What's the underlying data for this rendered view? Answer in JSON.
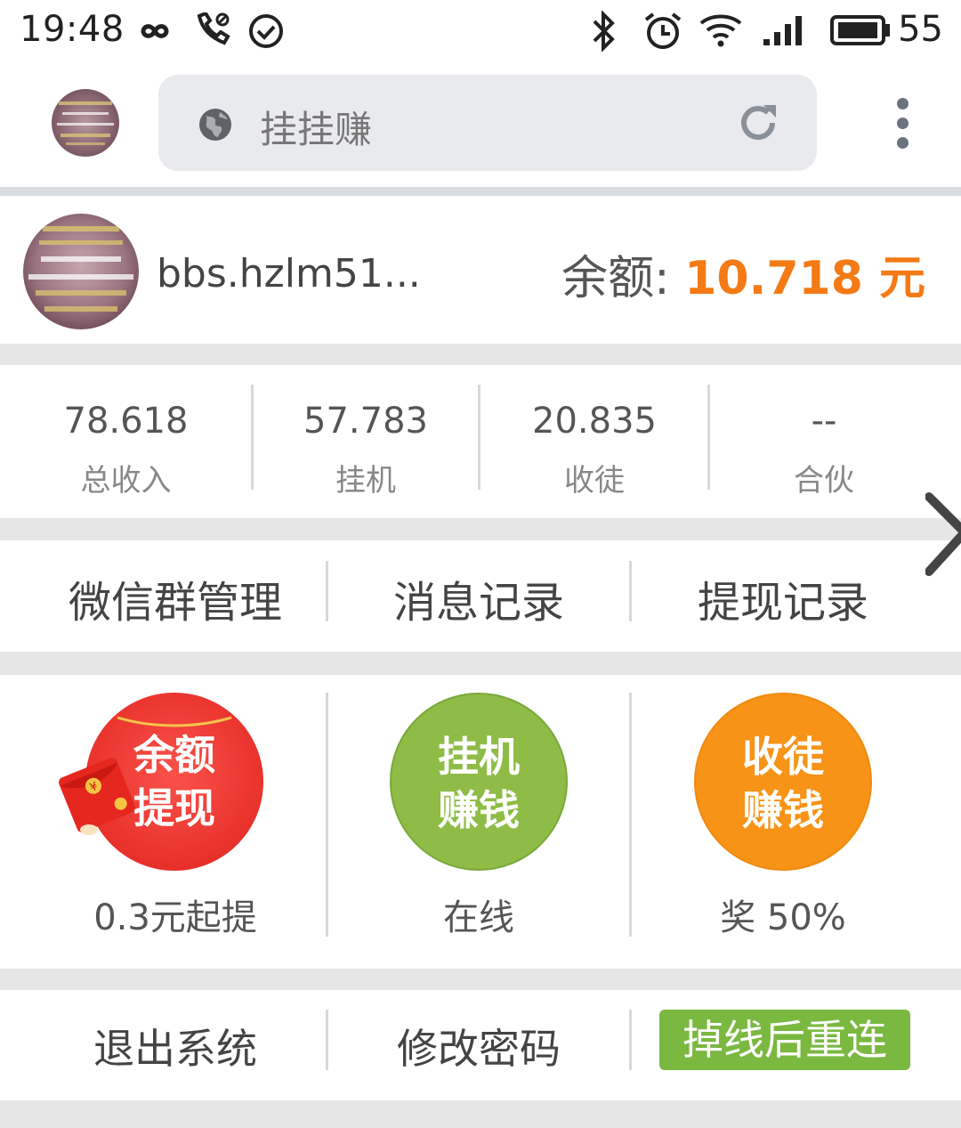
{
  "status_bar": {
    "time": "19:48",
    "battery": "55",
    "icons": [
      "infinity-icon",
      "call-icon",
      "check-circle-icon",
      "bluetooth-icon",
      "alarm-icon",
      "wifi-icon",
      "signal-icon",
      "battery-icon"
    ]
  },
  "browser": {
    "url_text": "挂挂赚",
    "icons": [
      "globe-icon",
      "reload-icon",
      "more-vert-icon"
    ]
  },
  "user": {
    "name": "bbs.hzlm51...",
    "balance_label": "余额:",
    "balance_value": "10.718 元",
    "accent_color": "#f47a16"
  },
  "stats": [
    {
      "value": "78.618",
      "label": "总收入"
    },
    {
      "value": "57.783",
      "label": "挂机"
    },
    {
      "value": "20.835",
      "label": "收徒"
    },
    {
      "value": "--",
      "label": "合伙"
    }
  ],
  "nav": [
    {
      "label": "微信群管理"
    },
    {
      "label": "消息记录"
    },
    {
      "label": "提现记录"
    }
  ],
  "actions": [
    {
      "line1": "余额",
      "line2": "提现",
      "sub": "0.3元起提",
      "color": "#e8312b"
    },
    {
      "line1": "挂机",
      "line2": "赚钱",
      "sub": "在线",
      "color": "#8ebc46"
    },
    {
      "line1": "收徒",
      "line2": "赚钱",
      "sub": "奖 50%",
      "color": "#f79317"
    }
  ],
  "bottom": {
    "logout": "退出系统",
    "change_password": "修改密码",
    "reconnect": "掉线后重连",
    "reconnect_color": "#7ab840"
  }
}
